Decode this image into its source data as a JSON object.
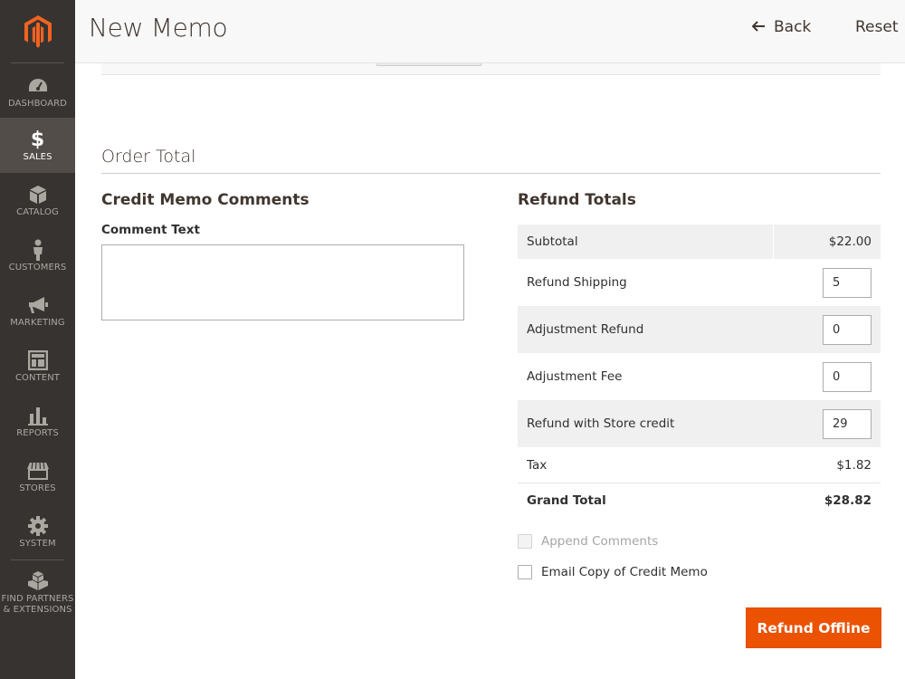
{
  "sidebar": {
    "items": [
      {
        "label": "DASHBOARD",
        "icon": "dashboard-icon"
      },
      {
        "label": "SALES",
        "icon": "dollar-icon",
        "active": true
      },
      {
        "label": "CATALOG",
        "icon": "cube-icon"
      },
      {
        "label": "CUSTOMERS",
        "icon": "person-icon"
      },
      {
        "label": "MARKETING",
        "icon": "megaphone-icon"
      },
      {
        "label": "CONTENT",
        "icon": "layout-icon"
      },
      {
        "label": "REPORTS",
        "icon": "bar-chart-icon"
      },
      {
        "label": "STORES",
        "icon": "storefront-icon"
      },
      {
        "label": "SYSTEM",
        "icon": "gear-icon"
      },
      {
        "label_line1": "FIND PARTNERS",
        "label_line2": "& EXTENSIONS",
        "icon": "boxes-icon"
      }
    ]
  },
  "header": {
    "title": "New Memo",
    "back_label": "Back",
    "reset_label": "Reset"
  },
  "order_total": {
    "title": "Order Total"
  },
  "comments": {
    "title": "Credit Memo Comments",
    "label": "Comment Text",
    "value": ""
  },
  "refund_totals": {
    "title": "Refund Totals",
    "subtotal_label": "Subtotal",
    "subtotal_value": "$22.00",
    "shipping_label": "Refund Shipping",
    "shipping_value": "5",
    "adj_refund_label": "Adjustment Refund",
    "adj_refund_value": "0",
    "adj_fee_label": "Adjustment Fee",
    "adj_fee_value": "0",
    "store_credit_label": "Refund with Store credit",
    "store_credit_value": "29",
    "tax_label": "Tax",
    "tax_value": "$1.82",
    "grand_total_label": "Grand Total",
    "grand_total_value": "$28.82"
  },
  "options": {
    "append_comments": "Append Comments",
    "email_copy": "Email Copy of Credit Memo"
  },
  "actions": {
    "refund_offline": "Refund Offline"
  },
  "colors": {
    "sidebar_bg": "#373330",
    "sidebar_active": "#524d49",
    "logo_orange": "#f26322",
    "primary_button": "#eb5202"
  }
}
